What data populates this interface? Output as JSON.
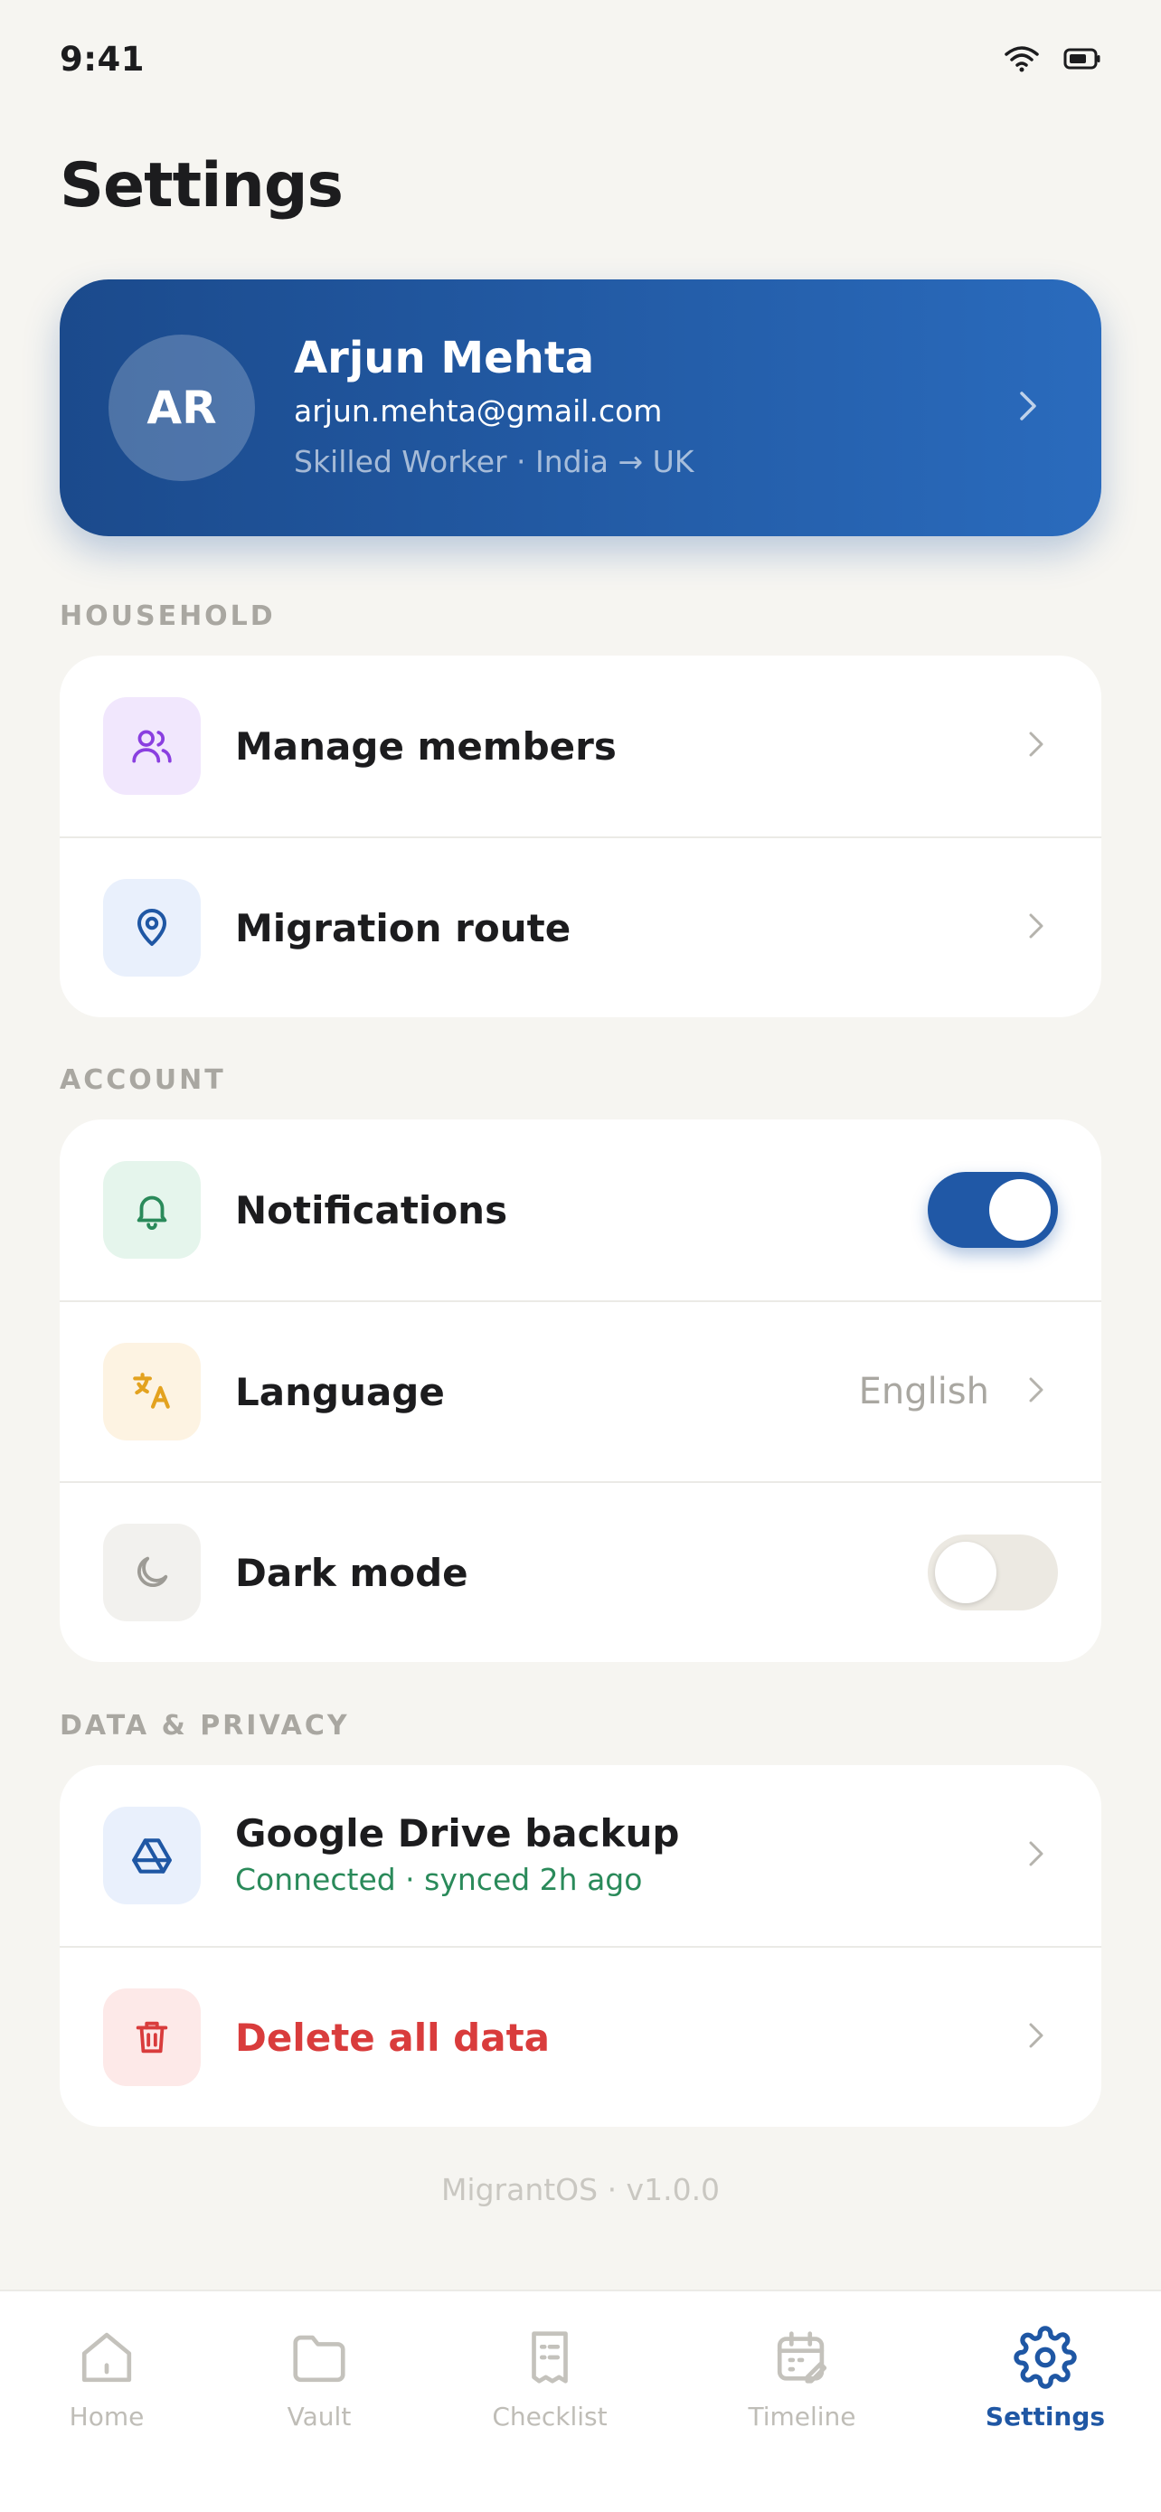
{
  "status_bar": {
    "time": "9:41",
    "icons": [
      "wifi-icon",
      "battery-icon"
    ]
  },
  "page": {
    "title": "Settings"
  },
  "profile": {
    "initials": "AR",
    "name": "Arjun Mehta",
    "email": "arjun.mehta@gmail.com",
    "subtitle": "Skilled Worker · India → UK"
  },
  "sections": {
    "household": {
      "label": "HOUSEHOLD",
      "items": [
        {
          "label": "Manage members",
          "icon": "users-icon"
        },
        {
          "label": "Migration route",
          "icon": "map-pin-icon"
        }
      ]
    },
    "account": {
      "label": "ACCOUNT",
      "items": [
        {
          "label": "Notifications",
          "icon": "bell-icon",
          "toggle": true
        },
        {
          "label": "Language",
          "icon": "translate-icon",
          "value": "English"
        },
        {
          "label": "Dark mode",
          "icon": "moon-icon",
          "toggle": false
        }
      ]
    },
    "privacy": {
      "label": "DATA & PRIVACY",
      "items": [
        {
          "label": "Google Drive backup",
          "sub": "Connected · synced 2h ago",
          "icon": "google-drive-icon"
        },
        {
          "label": "Delete all data",
          "icon": "trash-icon"
        }
      ]
    }
  },
  "footer": {
    "version": "MigrantOS · v1.0.0"
  },
  "nav": {
    "items": [
      {
        "label": "Home",
        "icon": "home-icon"
      },
      {
        "label": "Vault",
        "icon": "folder-icon"
      },
      {
        "label": "Checklist",
        "icon": "checklist-icon"
      },
      {
        "label": "Timeline",
        "icon": "calendar-icon"
      },
      {
        "label": "Settings",
        "icon": "gear-icon"
      }
    ],
    "active": "Settings"
  },
  "colors": {
    "accent": "#1f57a4",
    "background": "#f6f5f1",
    "danger": "#d93c3c",
    "success": "#2a8a5a"
  }
}
